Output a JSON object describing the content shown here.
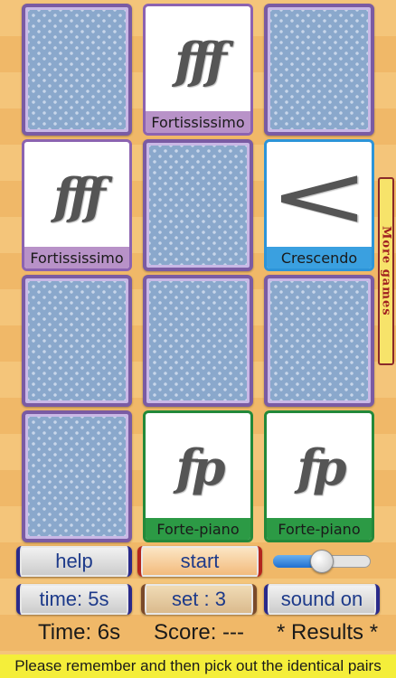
{
  "board": {
    "cards": [
      {
        "state": "facedown"
      },
      {
        "state": "faceup",
        "symbol": "fff",
        "label": "Fortississimo",
        "theme": "purple"
      },
      {
        "state": "facedown"
      },
      {
        "state": "faceup",
        "symbol": "fff",
        "label": "Fortississimo",
        "theme": "purple"
      },
      {
        "state": "facedown"
      },
      {
        "state": "faceup",
        "symbol": "<",
        "label": "Crescendo",
        "theme": "blue"
      },
      {
        "state": "facedown"
      },
      {
        "state": "facedown"
      },
      {
        "state": "facedown"
      },
      {
        "state": "facedown"
      },
      {
        "state": "faceup",
        "symbol": "fp",
        "label": "Forte-piano",
        "theme": "green"
      },
      {
        "state": "faceup",
        "symbol": "fp",
        "label": "Forte-piano",
        "theme": "green"
      }
    ]
  },
  "side_tab": {
    "label": "More games"
  },
  "controls": {
    "help_label": "help",
    "start_label": "start",
    "time_label": "time: 5s",
    "set_label": "set : 3",
    "sound_label": "sound on",
    "volume_slider": {
      "value": 0.5
    }
  },
  "status": {
    "time": "Time: 6s",
    "score": "Score: ---",
    "results": "* Results *"
  },
  "footer": {
    "instruction": "Please remember and then pick out the identical pairs"
  },
  "colors": {
    "purple": "#8c63b0",
    "blue": "#2c94d8",
    "green": "#23893a",
    "card_back": "#8aa8cc",
    "banner": "#f4ee3a"
  }
}
